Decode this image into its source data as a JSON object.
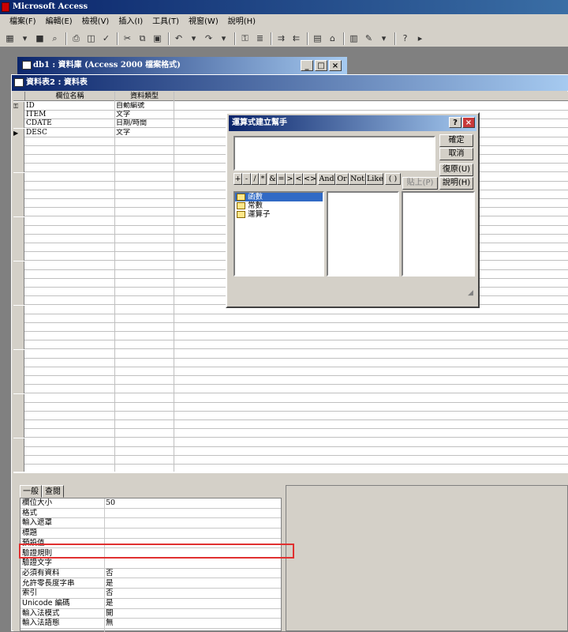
{
  "app": {
    "title": "Microsoft Access"
  },
  "menu": [
    "檔案(F)",
    "編輯(E)",
    "檢視(V)",
    "插入(I)",
    "工具(T)",
    "視窗(W)",
    "說明(H)"
  ],
  "db_window": {
    "title": "db1 : 資料庫 (Access 2000 檔案格式)"
  },
  "table_window": {
    "title": "資料表2 : 資料表"
  },
  "grid": {
    "headers": [
      "欄位名稱",
      "資料類型"
    ],
    "rows": [
      {
        "name": "ID",
        "type": "自動編號",
        "key": true
      },
      {
        "name": "ITEM",
        "type": "文字"
      },
      {
        "name": "CDATE",
        "type": "日期/時間"
      },
      {
        "name": "DESC",
        "type": "文字",
        "current": true
      }
    ]
  },
  "props": {
    "tabs": [
      "一般",
      "查閱"
    ],
    "rows": [
      {
        "label": "欄位大小",
        "value": "50"
      },
      {
        "label": "格式",
        "value": ""
      },
      {
        "label": "輸入遮罩",
        "value": ""
      },
      {
        "label": "標題",
        "value": ""
      },
      {
        "label": "預設值",
        "value": ""
      },
      {
        "label": "驗證規則",
        "value": ""
      },
      {
        "label": "驗證文字",
        "value": ""
      },
      {
        "label": "必須有資料",
        "value": "否"
      },
      {
        "label": "允許零長度字串",
        "value": "是"
      },
      {
        "label": "索引",
        "value": "否"
      },
      {
        "label": "Unicode 編碼",
        "value": "是"
      },
      {
        "label": "輸入法模式",
        "value": "開"
      },
      {
        "label": "輸入法語態",
        "value": "無"
      }
    ]
  },
  "dialog": {
    "title": "運算式建立幫手",
    "help_btn": "?",
    "ok": "確定",
    "cancel": "取消",
    "undo": "復原(U)",
    "paste": "貼上(P)",
    "help": "說明(H)",
    "operators": [
      "+",
      "-",
      "/",
      "*",
      "&",
      "=",
      ">",
      "<",
      "<>",
      "And",
      "Or",
      "Not",
      "Like",
      "( )"
    ],
    "tree": [
      "函數",
      "常數",
      "運算子"
    ]
  },
  "colors": {
    "title_start": "#0a246a",
    "title_end": "#a6caf0",
    "highlight": "#e03030",
    "chrome": "#d4d0c8"
  }
}
